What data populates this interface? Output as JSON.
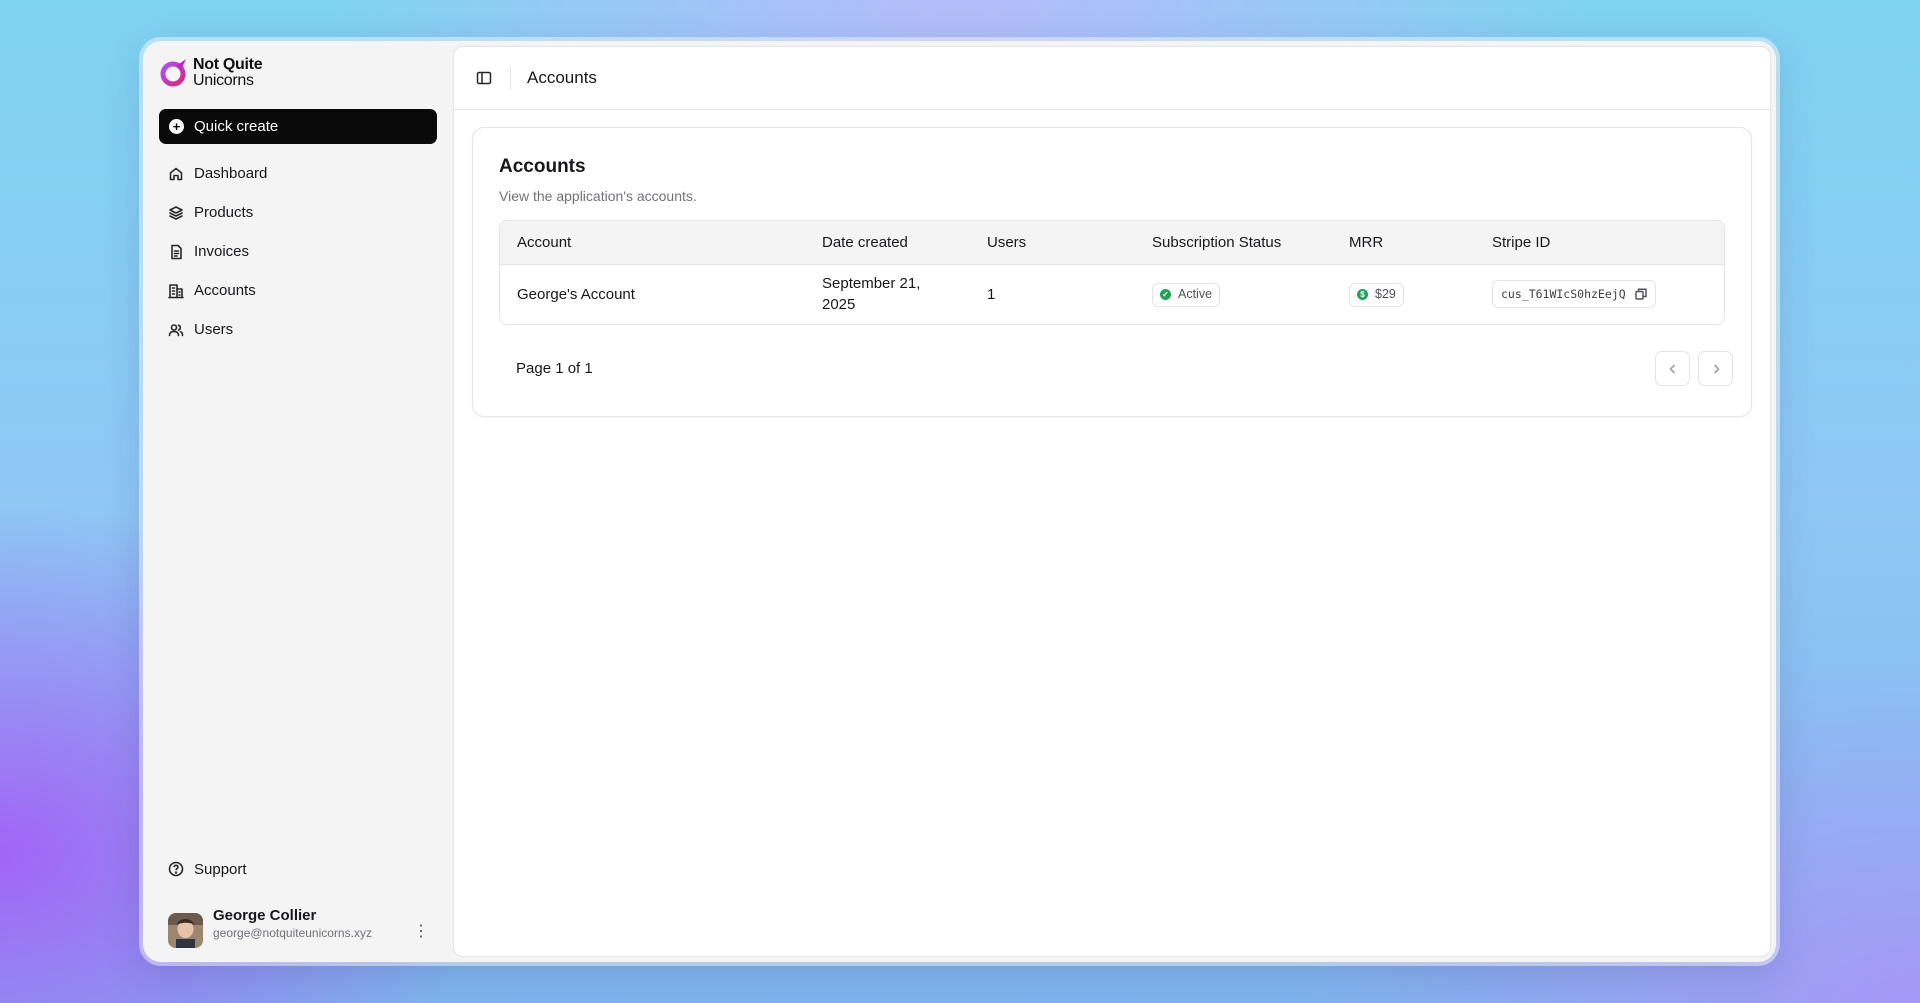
{
  "brand": {
    "name_line1": "Not Quite",
    "name_line2": "Unicorns",
    "colors": {
      "accent": "#c026d3",
      "accent2": "#a855f7"
    }
  },
  "sidebar": {
    "quick_create": "Quick create",
    "items": [
      {
        "label": "Dashboard",
        "icon": "home-icon"
      },
      {
        "label": "Products",
        "icon": "layers-icon"
      },
      {
        "label": "Invoices",
        "icon": "file-icon"
      },
      {
        "label": "Accounts",
        "icon": "building-icon"
      },
      {
        "label": "Users",
        "icon": "users-icon"
      }
    ],
    "support": "Support",
    "user": {
      "name": "George Collier",
      "email": "george@notquiteunicorns.xyz"
    }
  },
  "header": {
    "title": "Accounts"
  },
  "card": {
    "title": "Accounts",
    "description": "View the application's accounts.",
    "columns": [
      "Account",
      "Date created",
      "Users",
      "Subscription Status",
      "MRR",
      "Stripe ID"
    ],
    "rows": [
      {
        "account": "George's Account",
        "date_created": "September 21, 2025",
        "users": "1",
        "status": "Active",
        "mrr": "$29",
        "stripe_id": "cus_T61WIcS0hzEejQ"
      }
    ],
    "pagination": "Page 1 of 1"
  }
}
